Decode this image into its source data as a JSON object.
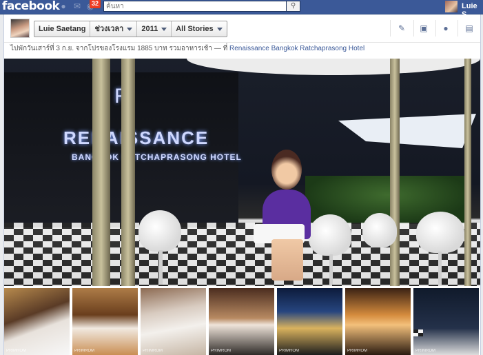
{
  "topbar": {
    "logo": "facebook",
    "notification_count": "32",
    "search_placeholder": "ค้นหา",
    "user_name": "Luie S"
  },
  "timeline_nav": {
    "name": "Luie Saetang",
    "period_label": "ช่วงเวลา",
    "year": "2011",
    "stories_filter": "All Stories"
  },
  "photo": {
    "caption": "ไปพักวันเสาร์ที่ 3 ก.ย. จากโปรของโรงแรม 1885 บาท รวมอาหารเช้า",
    "place_prefix": "— ที่",
    "place": "Renaissance Bangkok Ratchaprasong Hotel",
    "sign_main": "RENAISSANCE",
    "sign_sub": "BANGKOK RATCHAPRASONG HOTEL",
    "sign_letter": "R"
  },
  "thumbnails": [
    {
      "watermark": "PRIMROM"
    },
    {
      "watermark": "PRIMROM"
    },
    {
      "watermark": "PRIMROM"
    },
    {
      "watermark": "PRIMROM"
    },
    {
      "watermark": "PRIMROM"
    },
    {
      "watermark": "PRIMROM"
    },
    {
      "watermark": "PRIMROM"
    }
  ]
}
